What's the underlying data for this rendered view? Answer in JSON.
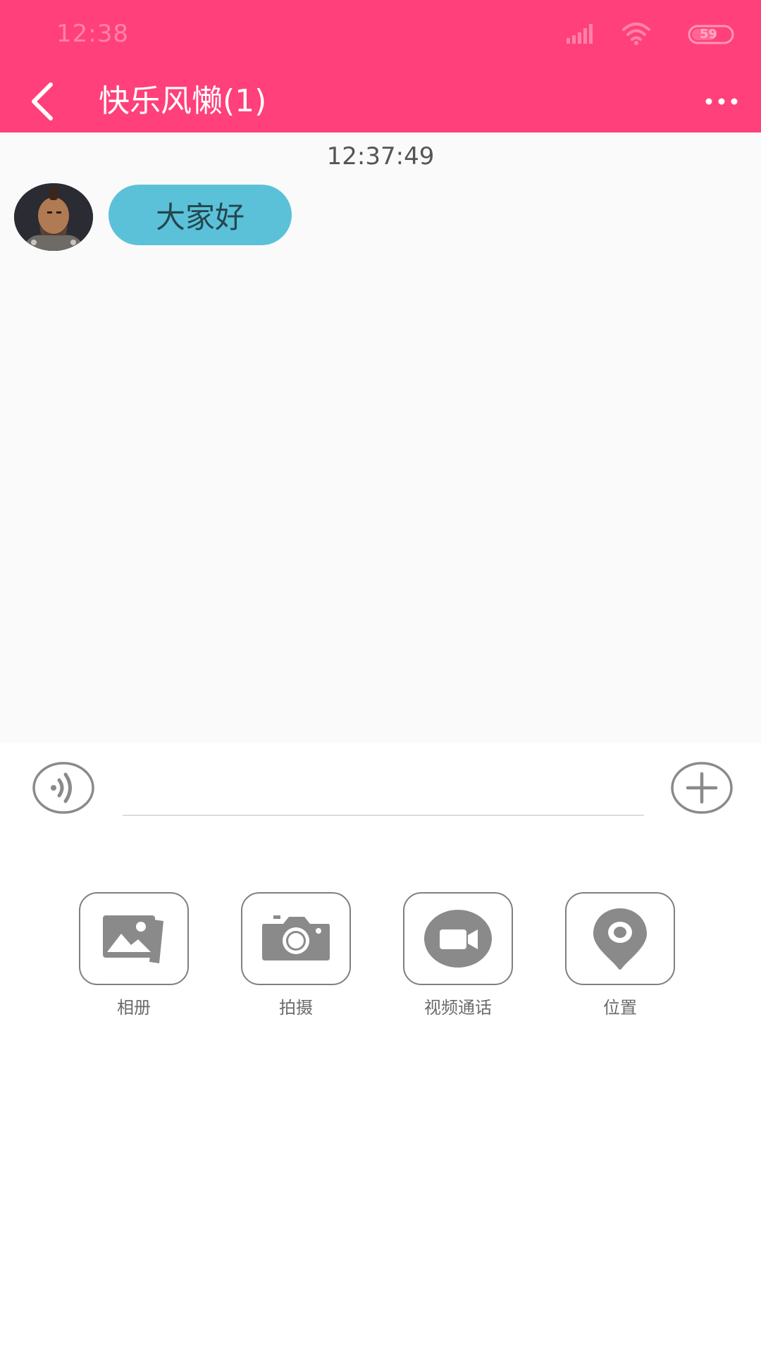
{
  "status_bar": {
    "time": "12:38",
    "battery": "59",
    "icons": [
      "signal-icon",
      "wifi-icon",
      "battery-icon"
    ]
  },
  "app_bar": {
    "title": "快乐风懒(1)",
    "back_icon": "back-arrow-icon",
    "more_icon": "more-dots-icon",
    "color": "#ff407b"
  },
  "chat": {
    "messages": [
      {
        "timestamp": "12:37:49",
        "text": "大家好",
        "bubble_color": "#5bc1d8"
      }
    ]
  },
  "input": {
    "value": "",
    "placeholder": "",
    "voice_icon": "voice-icon",
    "plus_icon": "plus-icon"
  },
  "tools": [
    {
      "label": "相册",
      "icon": "album-icon"
    },
    {
      "label": "拍摄",
      "icon": "camera-icon"
    },
    {
      "label": "视频通话",
      "icon": "video-call-icon"
    },
    {
      "label": "位置",
      "icon": "location-icon"
    }
  ]
}
